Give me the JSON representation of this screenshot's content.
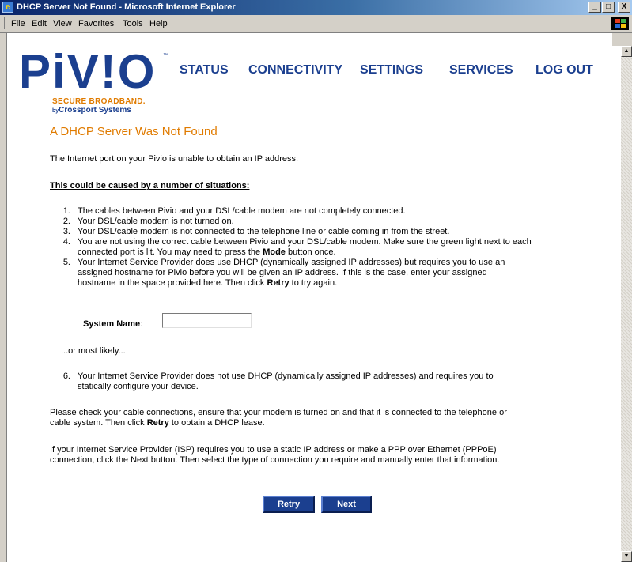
{
  "window": {
    "title": "DHCP Server Not Found - Microsoft Internet Explorer",
    "minimize_glyph": "_",
    "maximize_glyph": "□",
    "close_glyph": "X"
  },
  "menu": {
    "items": [
      "File",
      "Edit",
      "View",
      "Favorites",
      "Tools",
      "Help"
    ]
  },
  "logo": {
    "wordmark": "PiV!O",
    "trademark": "™",
    "tagline": "SECURE BROADBAND.",
    "byline_prefix": "by",
    "byline": "Crossport Systems"
  },
  "nav": [
    "STATUS",
    "CONNECTIVITY",
    "SETTINGS",
    "SERVICES",
    "LOG OUT"
  ],
  "page": {
    "heading": "A DHCP Server Was Not Found",
    "intro": "The Internet port on your Pivio is unable to obtain an IP address.",
    "causes_heading": "This could be caused by a number of situations:",
    "items": [
      {
        "num": "1.",
        "lines": [
          "The cables between Pivio and your DSL/cable modem are not completely connected."
        ]
      },
      {
        "num": "2.",
        "lines": [
          "Your DSL/cable modem is not turned on."
        ]
      },
      {
        "num": "3.",
        "lines": [
          "Your DSL/cable modem is not connected to the telephone line or cable coming in from the street."
        ]
      },
      {
        "num": "4.",
        "line1": "You are not using the correct cable between Pivio and your DSL/cable modem. Make sure the green light next to each",
        "line2_pre": "connected port is lit. You may need to press the ",
        "line2_bold": "Mode",
        "line2_post": " button once."
      },
      {
        "num": "5.",
        "line1_pre": "Your Internet Service Provider ",
        "line1_underline": "does",
        "line1_post": " use DHCP (dynamically assigned IP addresses) but requires you to use an",
        "line2": "assigned hostname for Pivio before you will be given an IP address. If this is the case, enter your assigned",
        "line3_pre": "hostname in the space provided here. Then click ",
        "line3_bold": "Retry",
        "line3_post": " to try again."
      },
      {
        "num": "6.",
        "lines": [
          "Your Internet Service Provider does not use DHCP (dynamically assigned IP addresses) and requires you to",
          "statically configure your device."
        ]
      }
    ],
    "system_name_label": "System Name",
    "system_name_colon": ":",
    "system_name_value": "",
    "or_most_likely": "...or most likely...",
    "check_line1": "Please check your cable connections, ensure that your modem is turned on and that it is connected to the telephone or",
    "check_line2_pre": "cable system. Then click ",
    "check_line2_bold": "Retry",
    "check_line2_post": " to obtain a DHCP lease.",
    "isp_line1": "If your Internet Service Provider (ISP) requires you to use a static IP address or make a PPP over Ethernet (PPPoE)",
    "isp_line2": "connection, click the Next button. Then select the type of connection you require and manually enter that information.",
    "retry_button": "Retry",
    "next_button": "Next"
  },
  "colors": {
    "brand_blue": "#1b3f8f",
    "brand_orange": "#e07b00"
  }
}
